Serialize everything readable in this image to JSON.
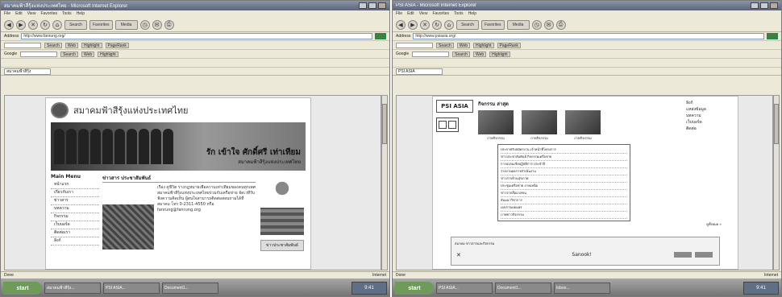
{
  "left": {
    "title": "สมาคมฟ้าสีรุ้งแห่งประเทศไทย - Microsoft Internet Explorer",
    "menu": [
      "File",
      "Edit",
      "View",
      "Favorites",
      "Tools",
      "Help"
    ],
    "toolbar": {
      "search": "Search",
      "favorites": "Favorites",
      "media": "Media"
    },
    "address": {
      "label": "Address",
      "url": "http://www.fanrung.org/"
    },
    "links_row_1": [
      "Search",
      "Web",
      "Highlight",
      "PageRank"
    ],
    "links_row_2": [
      "Google",
      "Search",
      "Web",
      "Highlight"
    ],
    "tab_label": "สมาคมฟ้าสีรุ้ง",
    "page": {
      "site_title": "สมาคมฟ้าสีรุ้งแห่งประเทศไทย",
      "slogan": "รัก เข้าใจ ศักดิ์ศรี เท่าเทียม",
      "slogan_sub": "สมาคมฟ้าสีรุ้งแห่งประเทศไทย",
      "sidebar_head": "Main Menu",
      "sidebar_items": [
        "หน้าแรก",
        "เกี่ยวกับเรา",
        "ข่าวสาร",
        "บทความ",
        "กิจกรรม",
        "เว็บบอร์ด",
        "ติดต่อเรา",
        "ลิงก์"
      ],
      "news_head": "ข่าวสาร ประชาสัมพันธ์",
      "news_text": "เรื่อง คู่ชีวิต ร่างกฎหมายเพื่อความเท่าเทียมของคนทุกเพศ สมาคมฟ้าสีรุ้งแห่งประเทศไทยร่วมกับเครือข่าย จัดเวทีรับฟังความคิดเห็น ผู้สนใจสามารถติดต่อสอบถามได้ที่สมาคม โทร 0-2311-4550 หรือ fanrung@fanrung.org",
      "rc_box": "ข่าวประชาสัมพันธ์"
    },
    "status": "Done",
    "status_right": "Internet"
  },
  "right": {
    "title": "PSI ASIA - Microsoft Internet Explorer",
    "menu": [
      "File",
      "Edit",
      "View",
      "Favorites",
      "Tools",
      "Help"
    ],
    "toolbar": {
      "search": "Search",
      "favorites": "Favorites",
      "media": "Media"
    },
    "address": {
      "label": "Address",
      "url": "http://www.psiasia.org/"
    },
    "links_row_1": [
      "Search",
      "Web",
      "Highlight",
      "PageRank"
    ],
    "links_row_2": [
      "Google",
      "Search",
      "Web",
      "Highlight"
    ],
    "tab_label": "PSI ASIA",
    "page": {
      "logo": "PSI ASIA",
      "gallery_head": "กิจกรรม ล่าสุด",
      "captions": [
        "ภาพกิจกรรม",
        "ภาพกิจกรรม",
        "ภาพกิจกรรม"
      ],
      "side_links": [
        "ลิงก์",
        "แหล่งข้อมูล",
        "บทความ",
        "เว็บบอร์ด",
        "ติดต่อ"
      ],
      "lines": [
        "ประกาศรับสมัครงาน เจ้าหน้าที่โครงการ",
        "ข่าวประชาสัมพันธ์ กิจกรรมเครือข่าย",
        "การอบรมเชิงปฏิบัติการ ประจำปี",
        "รายงานผลการดำเนินงาน",
        "ข่าวสารด้านสุขภาพ",
        "ประชุมเครือข่าย ภาคเหนือ",
        "ข่าวจากสื่อมวลชน",
        "สัมมนาวิชาการ",
        "เอกสารเผยแพร่",
        "ภาพข่าวกิจกรรม"
      ],
      "more": "ดูทั้งหมด »",
      "popup_text": "สมาคม ข่าวสารและกิจกรรม",
      "popup_brand": "Sanook!"
    },
    "status": "Done",
    "status_right": "Internet"
  },
  "taskbar": {
    "start": "start",
    "tasks": [
      "สมาคมฟ้าสีรุ้ง...",
      "PSI ASIA...",
      "Document1...",
      "Inbox..."
    ],
    "clock": "9:41"
  }
}
